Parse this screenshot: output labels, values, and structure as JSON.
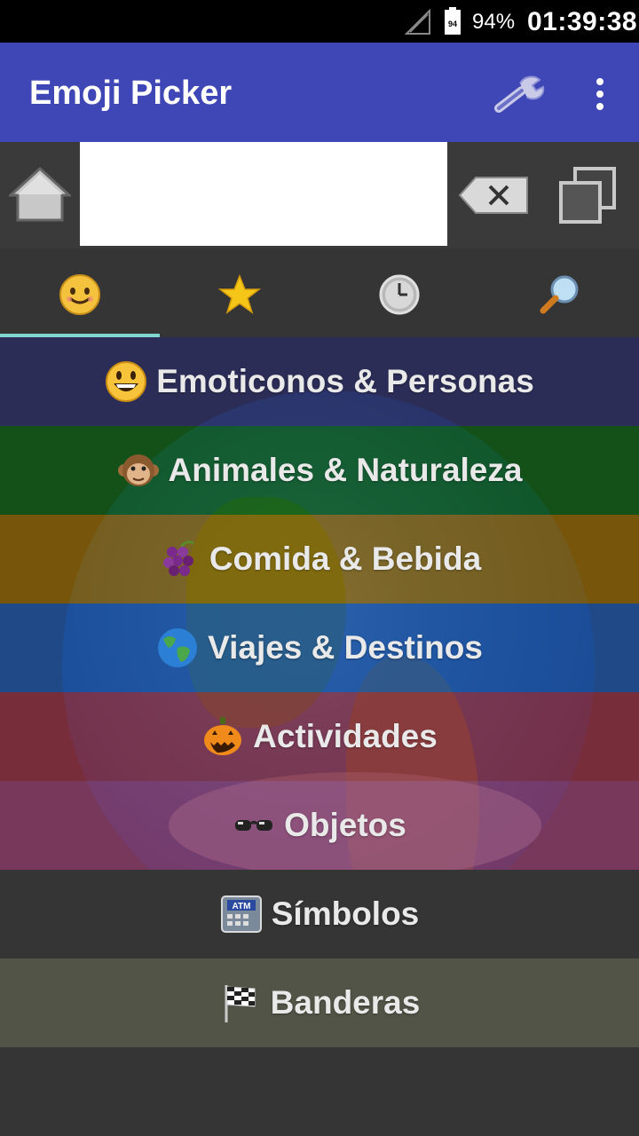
{
  "status": {
    "battery_level": "94",
    "battery_percent": "94%",
    "time": "01:39:38"
  },
  "app": {
    "title": "Emoji Picker",
    "accent": "#3f46b5"
  },
  "input": {
    "value": "",
    "placeholder": ""
  },
  "tabs": [
    {
      "name": "smileys",
      "icon": "smiley-icon",
      "selected": true
    },
    {
      "name": "favorites",
      "icon": "star-icon",
      "selected": false
    },
    {
      "name": "recent",
      "icon": "clock-icon",
      "selected": false
    },
    {
      "name": "search",
      "icon": "magnifier-icon",
      "selected": false
    }
  ],
  "categories": [
    {
      "emoji": "grinning-face",
      "label": "Emoticonos & Personas",
      "color": "#2a2c62"
    },
    {
      "emoji": "monkey-face",
      "label": "Animales & Naturaleza",
      "color": "#0b5a12"
    },
    {
      "emoji": "grapes",
      "label": "Comida & Bebida",
      "color": "#8a6000"
    },
    {
      "emoji": "globe",
      "label": "Viajes & Destinos",
      "color": "#1a4f9f"
    },
    {
      "emoji": "jack-o-lantern",
      "label": "Actividades",
      "color": "#8a2c3c"
    },
    {
      "emoji": "eyeglasses",
      "label": "Objetos",
      "color": "#8a3a68"
    },
    {
      "emoji": "atm-sign",
      "label": "Símbolos",
      "color": "#353535"
    },
    {
      "emoji": "checkered-flag",
      "label": "Banderas",
      "color": "#515446"
    }
  ]
}
